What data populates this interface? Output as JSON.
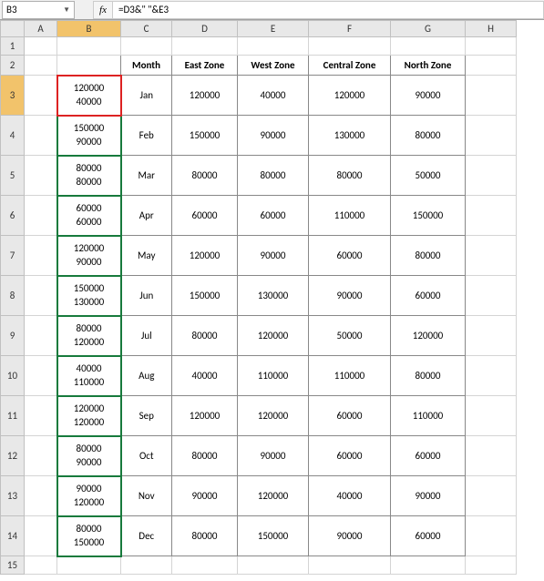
{
  "nameBox": "B3",
  "formula": "=D3&\" \"&E3",
  "fxLabel": "fx",
  "columns": [
    "A",
    "B",
    "C",
    "D",
    "E",
    "F",
    "G",
    "H"
  ],
  "headerRow": {
    "C": "Month",
    "D": "East Zone",
    "E": "West Zone",
    "F": "Central Zone",
    "G": "North Zone"
  },
  "rows": [
    {
      "r": 3,
      "b": "120000 40000",
      "m": "Jan",
      "d": 120000,
      "e": 40000,
      "f": 120000,
      "g": 90000
    },
    {
      "r": 4,
      "b": "150000 90000",
      "m": "Feb",
      "d": 150000,
      "e": 90000,
      "f": 130000,
      "g": 80000
    },
    {
      "r": 5,
      "b": "80000 80000",
      "m": "Mar",
      "d": 80000,
      "e": 80000,
      "f": 80000,
      "g": 50000
    },
    {
      "r": 6,
      "b": "60000 60000",
      "m": "Apr",
      "d": 60000,
      "e": 60000,
      "f": 110000,
      "g": 150000
    },
    {
      "r": 7,
      "b": "120000 90000",
      "m": "May",
      "d": 120000,
      "e": 90000,
      "f": 60000,
      "g": 80000
    },
    {
      "r": 8,
      "b": "150000 130000",
      "m": "Jun",
      "d": 150000,
      "e": 130000,
      "f": 90000,
      "g": 60000
    },
    {
      "r": 9,
      "b": "80000 120000",
      "m": "Jul",
      "d": 80000,
      "e": 120000,
      "f": 50000,
      "g": 120000
    },
    {
      "r": 10,
      "b": "40000 110000",
      "m": "Aug",
      "d": 40000,
      "e": 110000,
      "f": 110000,
      "g": 80000
    },
    {
      "r": 11,
      "b": "120000 120000",
      "m": "Sep",
      "d": 120000,
      "e": 120000,
      "f": 60000,
      "g": 110000
    },
    {
      "r": 12,
      "b": "80000 90000",
      "m": "Oct",
      "d": 80000,
      "e": 90000,
      "f": 60000,
      "g": 60000
    },
    {
      "r": 13,
      "b": "90000 120000",
      "m": "Nov",
      "d": 90000,
      "e": 120000,
      "f": 40000,
      "g": 90000
    },
    {
      "r": 14,
      "b": "80000 150000",
      "m": "Dec",
      "d": 80000,
      "e": 150000,
      "f": 90000,
      "g": 60000
    }
  ],
  "chart_data": {
    "type": "table",
    "title": "",
    "categories": [
      "Jan",
      "Feb",
      "Mar",
      "Apr",
      "May",
      "Jun",
      "Jul",
      "Aug",
      "Sep",
      "Oct",
      "Nov",
      "Dec"
    ],
    "series": [
      {
        "name": "East Zone",
        "values": [
          120000,
          150000,
          80000,
          60000,
          120000,
          150000,
          80000,
          40000,
          120000,
          80000,
          90000,
          80000
        ]
      },
      {
        "name": "West Zone",
        "values": [
          40000,
          90000,
          80000,
          60000,
          90000,
          130000,
          120000,
          110000,
          120000,
          90000,
          120000,
          150000
        ]
      },
      {
        "name": "Central Zone",
        "values": [
          120000,
          130000,
          80000,
          110000,
          60000,
          90000,
          50000,
          110000,
          60000,
          60000,
          40000,
          90000
        ]
      },
      {
        "name": "North Zone",
        "values": [
          90000,
          80000,
          50000,
          150000,
          80000,
          60000,
          120000,
          80000,
          110000,
          60000,
          90000,
          60000
        ]
      }
    ]
  }
}
